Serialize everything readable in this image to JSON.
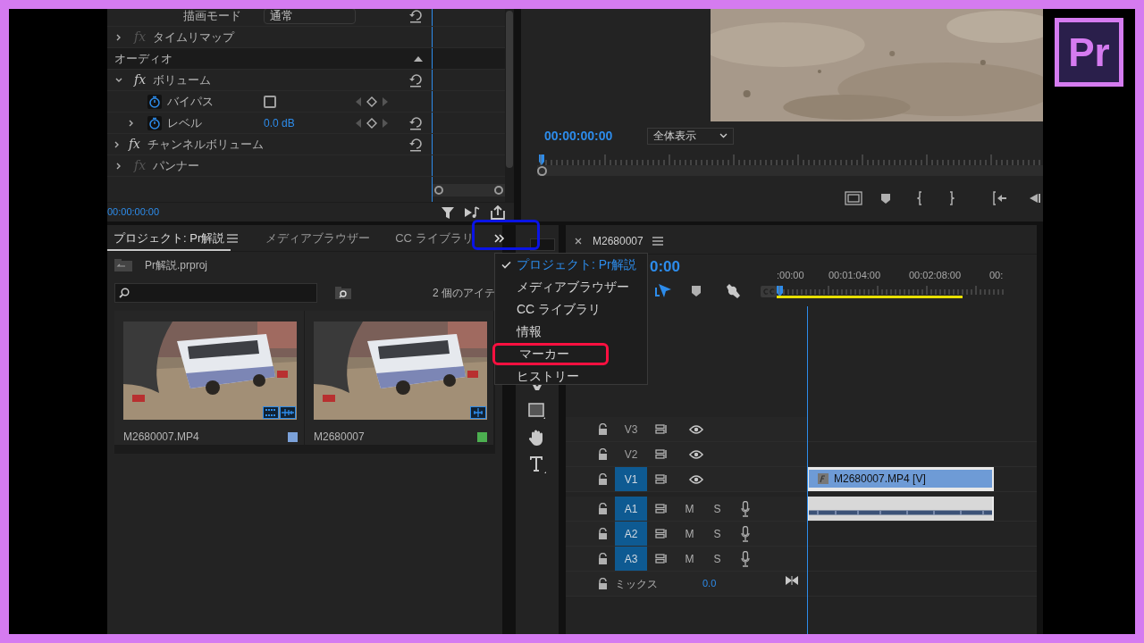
{
  "effect_controls": {
    "rows": [
      {
        "kind": "dropdown",
        "label": "描画モード",
        "value": "通常",
        "reset": true
      },
      {
        "kind": "effect",
        "badge": "fx",
        "label": "タイムリマップ",
        "expanded": false,
        "enabled": false,
        "reset": false
      },
      {
        "kind": "section",
        "label": "オーディオ"
      },
      {
        "kind": "effect",
        "badge": "fx",
        "label": "ボリューム",
        "expanded": true,
        "enabled": true,
        "reset": true
      },
      {
        "kind": "checkbox",
        "label": "バイパス",
        "checked": false,
        "reset": false
      },
      {
        "kind": "value",
        "label": "レベル",
        "value": "0.0 dB",
        "expanded": false,
        "reset": true
      },
      {
        "kind": "effect",
        "badge": "fx",
        "label": "チャンネルボリューム",
        "expanded": false,
        "enabled": true,
        "reset": true
      },
      {
        "kind": "effect",
        "badge": "fx",
        "label": "パンナー",
        "expanded": false,
        "enabled": false,
        "reset": false
      }
    ],
    "timecode": "00:00:00:00"
  },
  "program_monitor": {
    "timecode": "00:00:00:00",
    "zoom": "全体表示"
  },
  "project": {
    "tabs": [
      {
        "label": "プロジェクト: Pr解説",
        "selected": true
      },
      {
        "label": "メディアブラウザー",
        "selected": false
      },
      {
        "label": "CC ライブラリ",
        "selected": false
      }
    ],
    "overflow_annotated": true,
    "file": "Pr解説.prproj",
    "item_count": "2 個のアイテ",
    "items": [
      {
        "name": "M2680007.MP4",
        "kind": "clip",
        "color": "#7ba1d9"
      },
      {
        "name": "M2680007",
        "kind": "sequence",
        "color": "#4caf50"
      }
    ]
  },
  "menu": {
    "items": [
      {
        "label": "プロジェクト: Pr解説",
        "checked": true,
        "highlighted": false
      },
      {
        "label": "メディアブラウザー",
        "checked": false,
        "highlighted": false
      },
      {
        "label": "CC ライブラリ",
        "checked": false,
        "highlighted": false
      },
      {
        "label": "情報",
        "checked": false,
        "highlighted": false
      },
      {
        "label": "マーカー",
        "checked": false,
        "highlighted": true
      },
      {
        "label": "ヒストリー",
        "checked": false,
        "highlighted": false
      }
    ]
  },
  "timeline": {
    "tab": "M2680007",
    "timecode": "0:00",
    "ruler": [
      ":00:00",
      "00:01:04:00",
      "00:02:08:00",
      "00:"
    ],
    "tracks": [
      {
        "label": "V3",
        "kind": "video",
        "targeted": false
      },
      {
        "label": "V2",
        "kind": "video",
        "targeted": false
      },
      {
        "label": "V1",
        "kind": "video",
        "targeted": true,
        "clip": {
          "kind": "video",
          "label": "M2680007.MP4 [V]"
        }
      },
      {
        "label": "A1",
        "kind": "audio",
        "targeted": true,
        "mute": "M",
        "solo": "S",
        "clip": {
          "kind": "audio"
        }
      },
      {
        "label": "A2",
        "kind": "audio",
        "targeted": true,
        "mute": "M",
        "solo": "S"
      },
      {
        "label": "A3",
        "kind": "audio",
        "targeted": true,
        "mute": "M",
        "solo": "S"
      }
    ],
    "mix": {
      "label": "ミックス",
      "value": "0.0"
    }
  },
  "logo": {
    "text": "Pr"
  }
}
